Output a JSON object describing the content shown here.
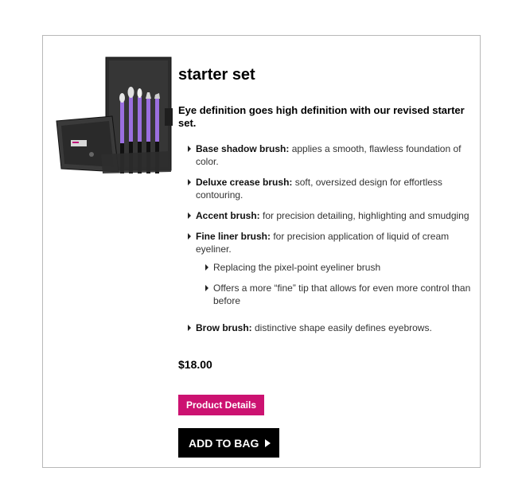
{
  "product": {
    "title": "starter set",
    "tagline": "Eye definition goes high definition with our revised starter set.",
    "price": "$18.00",
    "image_alt": "starter-set-brush-case-image"
  },
  "features": [
    {
      "name": "Base shadow brush:",
      "desc": " applies a smooth, flawless foundation of color."
    },
    {
      "name": "Deluxe crease brush:",
      "desc": " soft, oversized design for effortless contouring."
    },
    {
      "name": "Accent brush:",
      "desc": " for precision detailing, highlighting and smudging"
    },
    {
      "name": "Fine liner brush:",
      "desc": " for precision application of liquid of cream eyeliner.",
      "sub": [
        "Replacing the pixel-point eyeliner brush",
        "Offers a more “fine” tip that allows for even more control than before"
      ]
    },
    {
      "name": "Brow brush:",
      "desc": " distinctive shape easily defines eyebrows."
    }
  ],
  "buttons": {
    "details_label": "Product Details",
    "add_to_bag_label": "ADD TO BAG"
  },
  "colors": {
    "details_button": "#cc1271",
    "add_to_bag_button": "#000000",
    "brush_handle": "#9b6fe0",
    "case": "#2a2a2a"
  }
}
